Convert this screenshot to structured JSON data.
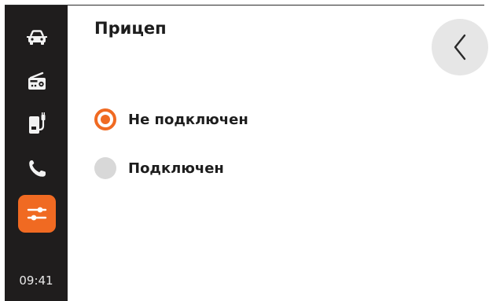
{
  "sidebar": {
    "items": [
      {
        "icon": "car-icon",
        "active": false
      },
      {
        "icon": "radio-icon",
        "active": false
      },
      {
        "icon": "charging-icon",
        "active": false
      },
      {
        "icon": "phone-icon",
        "active": false
      },
      {
        "icon": "settings-sliders-icon",
        "active": true
      }
    ],
    "clock": "09:41"
  },
  "header": {
    "title": "Прицеп",
    "back_icon": "chevron-left-icon"
  },
  "trailer_options": [
    {
      "label": "Не подключен",
      "selected": true
    },
    {
      "label": "Подключен",
      "selected": false
    }
  ],
  "colors": {
    "accent": "#f06a22",
    "sidebar_bg": "#1f1d1d",
    "back_button_bg": "#e6e6e6",
    "radio_off": "#d8d8d8"
  }
}
